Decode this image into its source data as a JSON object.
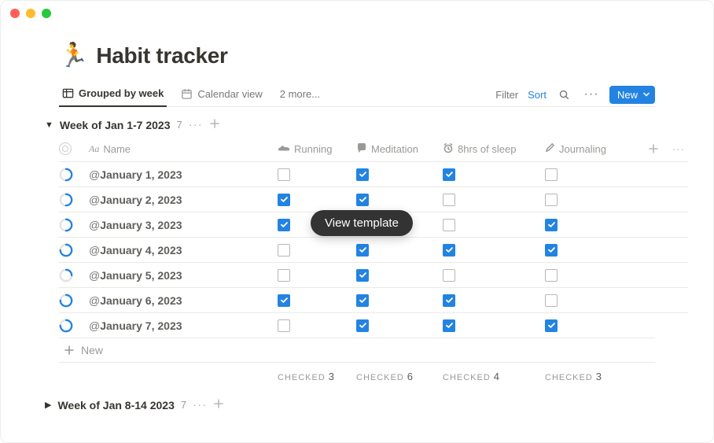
{
  "page": {
    "icon": "🏃",
    "title": "Habit tracker"
  },
  "views": {
    "active": {
      "label": "Grouped by week"
    },
    "calendar": {
      "label": "Calendar view"
    },
    "more": {
      "label": "2 more..."
    }
  },
  "toolbar": {
    "filter": "Filter",
    "sort": "Sort",
    "new": "New"
  },
  "columns": {
    "name": "Name",
    "running": "Running",
    "meditation": "Meditation",
    "sleep": "8hrs of sleep",
    "journaling": "Journaling"
  },
  "groups": [
    {
      "name": "Week of Jan 1-7 2023",
      "count": "7",
      "expanded": true,
      "rows": [
        {
          "date": "January 1, 2023",
          "progress": 0.5,
          "running": false,
          "meditation": true,
          "sleep": true,
          "journaling": false
        },
        {
          "date": "January 2, 2023",
          "progress": 0.5,
          "running": true,
          "meditation": true,
          "sleep": false,
          "journaling": false
        },
        {
          "date": "January 3, 2023",
          "progress": 0.5,
          "running": true,
          "meditation": false,
          "sleep": false,
          "journaling": true
        },
        {
          "date": "January 4, 2023",
          "progress": 0.75,
          "running": false,
          "meditation": true,
          "sleep": true,
          "journaling": true
        },
        {
          "date": "January 5, 2023",
          "progress": 0.25,
          "running": false,
          "meditation": true,
          "sleep": false,
          "journaling": false
        },
        {
          "date": "January 6, 2023",
          "progress": 0.75,
          "running": true,
          "meditation": true,
          "sleep": true,
          "journaling": false
        },
        {
          "date": "January 7, 2023",
          "progress": 0.75,
          "running": false,
          "meditation": true,
          "sleep": true,
          "journaling": true
        }
      ],
      "footer": {
        "label": "CHECKED",
        "running": "3",
        "meditation": "6",
        "sleep": "4",
        "journaling": "3"
      }
    },
    {
      "name": "Week of Jan 8-14 2023",
      "count": "7",
      "expanded": false
    }
  ],
  "new_row": "New",
  "template_pill": "View template"
}
